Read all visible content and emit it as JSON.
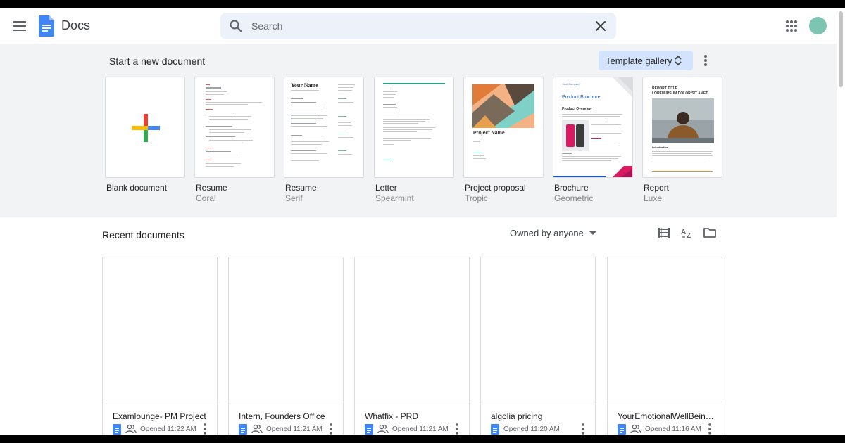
{
  "header": {
    "app_name": "Docs",
    "search_placeholder": "Search",
    "colors": {
      "doc_blue": "#4285f4",
      "avatar": "#7cc5b2",
      "search_bg": "#edf2fa"
    }
  },
  "templates": {
    "title": "Start a new document",
    "gallery_label": "Template gallery",
    "items": [
      {
        "name": "Blank document",
        "sub": ""
      },
      {
        "name": "Resume",
        "sub": "Coral"
      },
      {
        "name": "Resume",
        "sub": "Serif"
      },
      {
        "name": "Letter",
        "sub": "Spearmint"
      },
      {
        "name": "Project proposal",
        "sub": "Tropic"
      },
      {
        "name": "Brochure",
        "sub": "Geometric"
      },
      {
        "name": "Report",
        "sub": "Luxe"
      }
    ],
    "thumb_text": {
      "serif_name": "Your Name",
      "proposal_title": "Project Name",
      "brochure_company": "Your Company",
      "brochure_title": "Product Brochure",
      "brochure_overview": "Product Overview",
      "report_title": "REPORT TITLE",
      "report_subtitle": "LOREM IPSUM DOLOR SIT AMET",
      "report_section": "Introduction"
    }
  },
  "recent": {
    "title": "Recent documents",
    "owner_filter": "Owned by anyone",
    "docs": [
      {
        "title": "Examlounge- PM Project",
        "opened": "Opened 11:22 AM",
        "shared": true
      },
      {
        "title": "Intern, Founders Office",
        "opened": "Opened 11:21 AM",
        "shared": true
      },
      {
        "title": "Whatfix - PRD",
        "opened": "Opened 11:21 AM",
        "shared": true
      },
      {
        "title": "algolia pricing",
        "opened": "Opened 11:20 AM",
        "shared": false
      },
      {
        "title": "YourEmotionalWellBeing ...",
        "opened": "Opened 11:16 AM",
        "shared": true
      }
    ]
  }
}
